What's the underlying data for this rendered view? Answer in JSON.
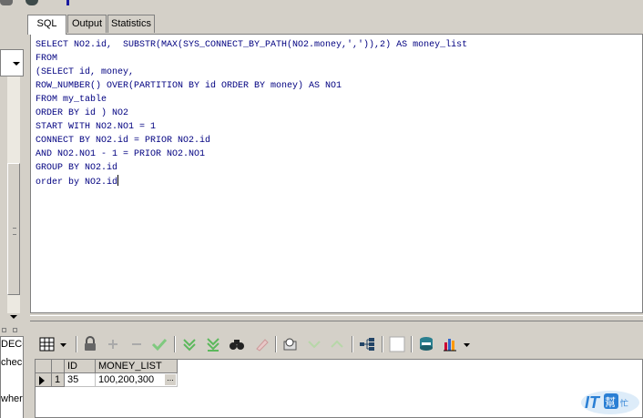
{
  "tabs": [
    {
      "label": "SQL",
      "active": true
    },
    {
      "label": "Output",
      "active": false
    },
    {
      "label": "Statistics",
      "active": false
    }
  ],
  "editor": {
    "lines": [
      "SELECT NO2.id,  SUBSTR(MAX(SYS_CONNECT_BY_PATH(NO2.money,',')),2) AS money_list",
      "FROM",
      "(SELECT id, money,",
      "ROW_NUMBER() OVER(PARTITION BY id ORDER BY money) AS NO1",
      "FROM my_table",
      "ORDER BY id ) NO2",
      "START WITH NO2.NO1 = 1",
      "CONNECT BY NO2.id = PRIOR NO2.id",
      "AND NO2.NO1 - 1 = PRIOR NO2.NO1",
      "GROUP BY NO2.id",
      "order by NO2.id"
    ],
    "text_color": "#000080"
  },
  "left_panel": {
    "rows": [
      "DECO",
      "chec",
      "where"
    ]
  },
  "grid": {
    "columns": [
      "ID",
      "MONEY_LIST"
    ],
    "rows": [
      {
        "row_num": "1",
        "id": "35",
        "money_list": "100,200,300"
      }
    ],
    "ellipsis": "..."
  },
  "toolbar": {
    "buttons": [
      "grid-layout-icon",
      "dropdown-arrow-icon",
      "lock-icon",
      "add-record-icon",
      "delete-record-icon",
      "post-record-icon",
      "fetch-next-icon",
      "fetch-last-icon",
      "find-icon",
      "clear-icon",
      "query-by-example-icon",
      "next-record-icon",
      "previous-record-icon",
      "tree-icon",
      "single-record-icon",
      "export-icon",
      "chart-icon"
    ]
  },
  "watermark": {
    "text": "IT",
    "sub": "幫忙"
  },
  "colors": {
    "window_bg": "#d4d0c8",
    "sql_text": "#000080",
    "green_check": "#5cb85c",
    "watermark_blue": "#2a7fd4"
  }
}
